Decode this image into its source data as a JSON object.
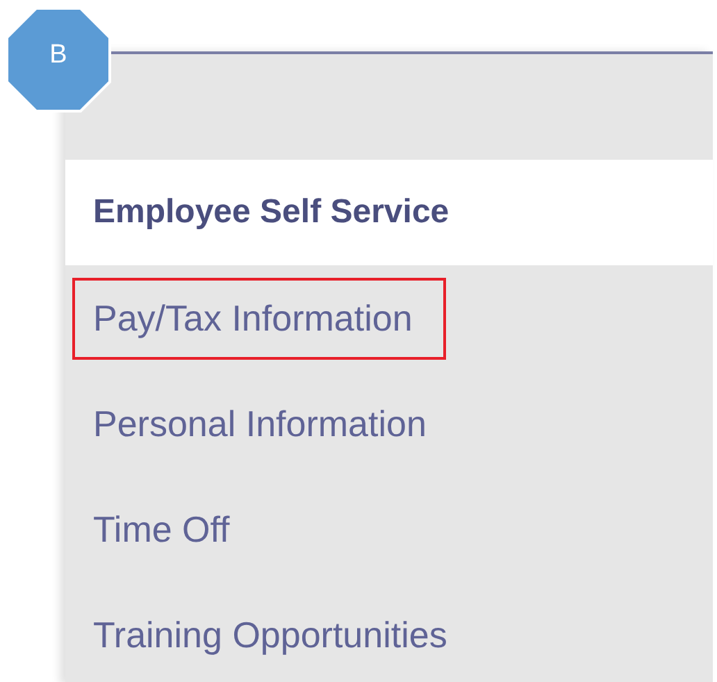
{
  "badge": {
    "label": "B"
  },
  "menu": {
    "heading": "Employee Self Service",
    "items": [
      {
        "label": "Pay/Tax Information",
        "highlighted": true
      },
      {
        "label": "Personal Information",
        "highlighted": false
      },
      {
        "label": "Time Off",
        "highlighted": false
      },
      {
        "label": "Training Opportunities",
        "highlighted": false
      }
    ]
  }
}
